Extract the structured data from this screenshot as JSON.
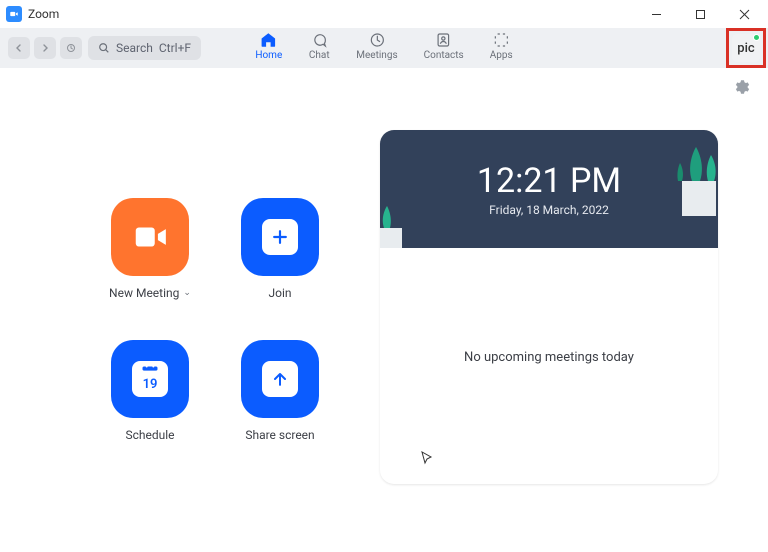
{
  "window": {
    "title": "Zoom"
  },
  "toolbar": {
    "search_label": "Search",
    "search_shortcut": "Ctrl+F"
  },
  "nav": {
    "home": "Home",
    "chat": "Chat",
    "meetings": "Meetings",
    "contacts": "Contacts",
    "apps": "Apps"
  },
  "avatar": {
    "text": "pic"
  },
  "actions": {
    "new_meeting": "New Meeting",
    "join": "Join",
    "schedule": "Schedule",
    "share_screen": "Share screen",
    "calendar_day": "19"
  },
  "card": {
    "time": "12:21 PM",
    "date": "Friday, 18 March, 2022",
    "empty_state": "No upcoming meetings today"
  }
}
